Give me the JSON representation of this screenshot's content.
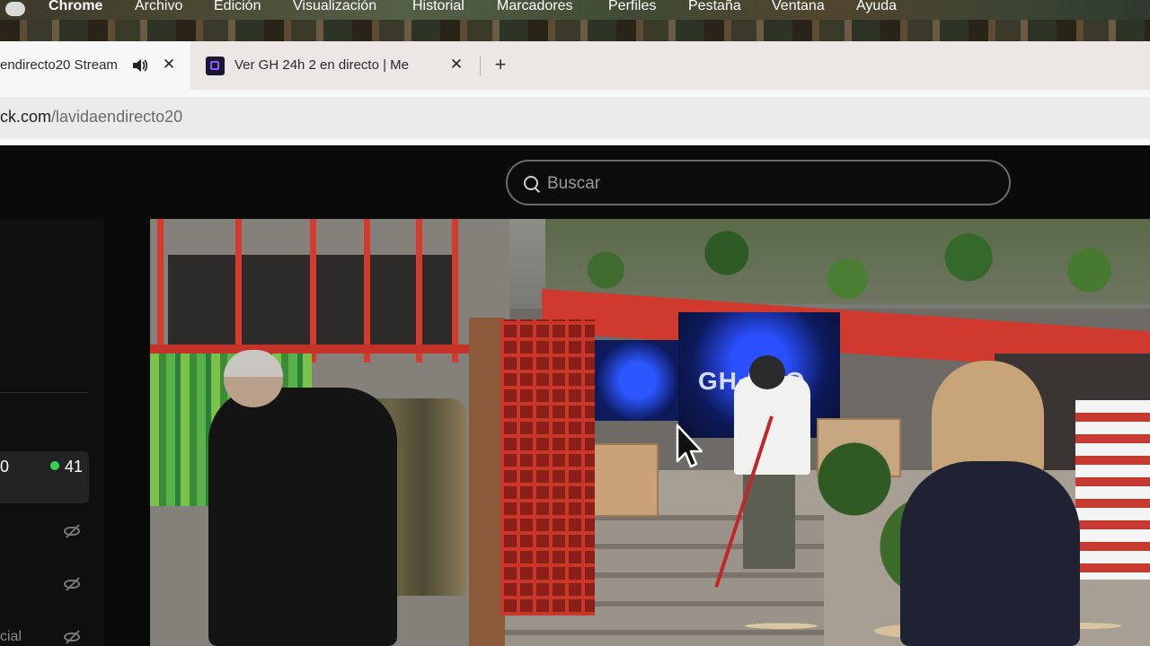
{
  "menubar": {
    "app_name": "Chrome",
    "items": [
      "Archivo",
      "Edición",
      "Visualización",
      "Historial",
      "Marcadores",
      "Perfiles",
      "Pestaña",
      "Ventana",
      "Ayuda"
    ]
  },
  "tabs": [
    {
      "title": "endirecto20 Stream",
      "active": true,
      "audio": true
    },
    {
      "title": "Ver GH 24h 2 en directo | Me",
      "active": false
    }
  ],
  "address_bar": {
    "host": "ck.com",
    "path": "/lavidaendirecto20"
  },
  "site": {
    "search_placeholder": "Buscar",
    "sidebar": {
      "left_number": "0",
      "viewer_count": "41",
      "social_label": "cial",
      "live_dot_color": "#35d25a"
    },
    "video_screen_text": "GH·ÑÚO"
  }
}
